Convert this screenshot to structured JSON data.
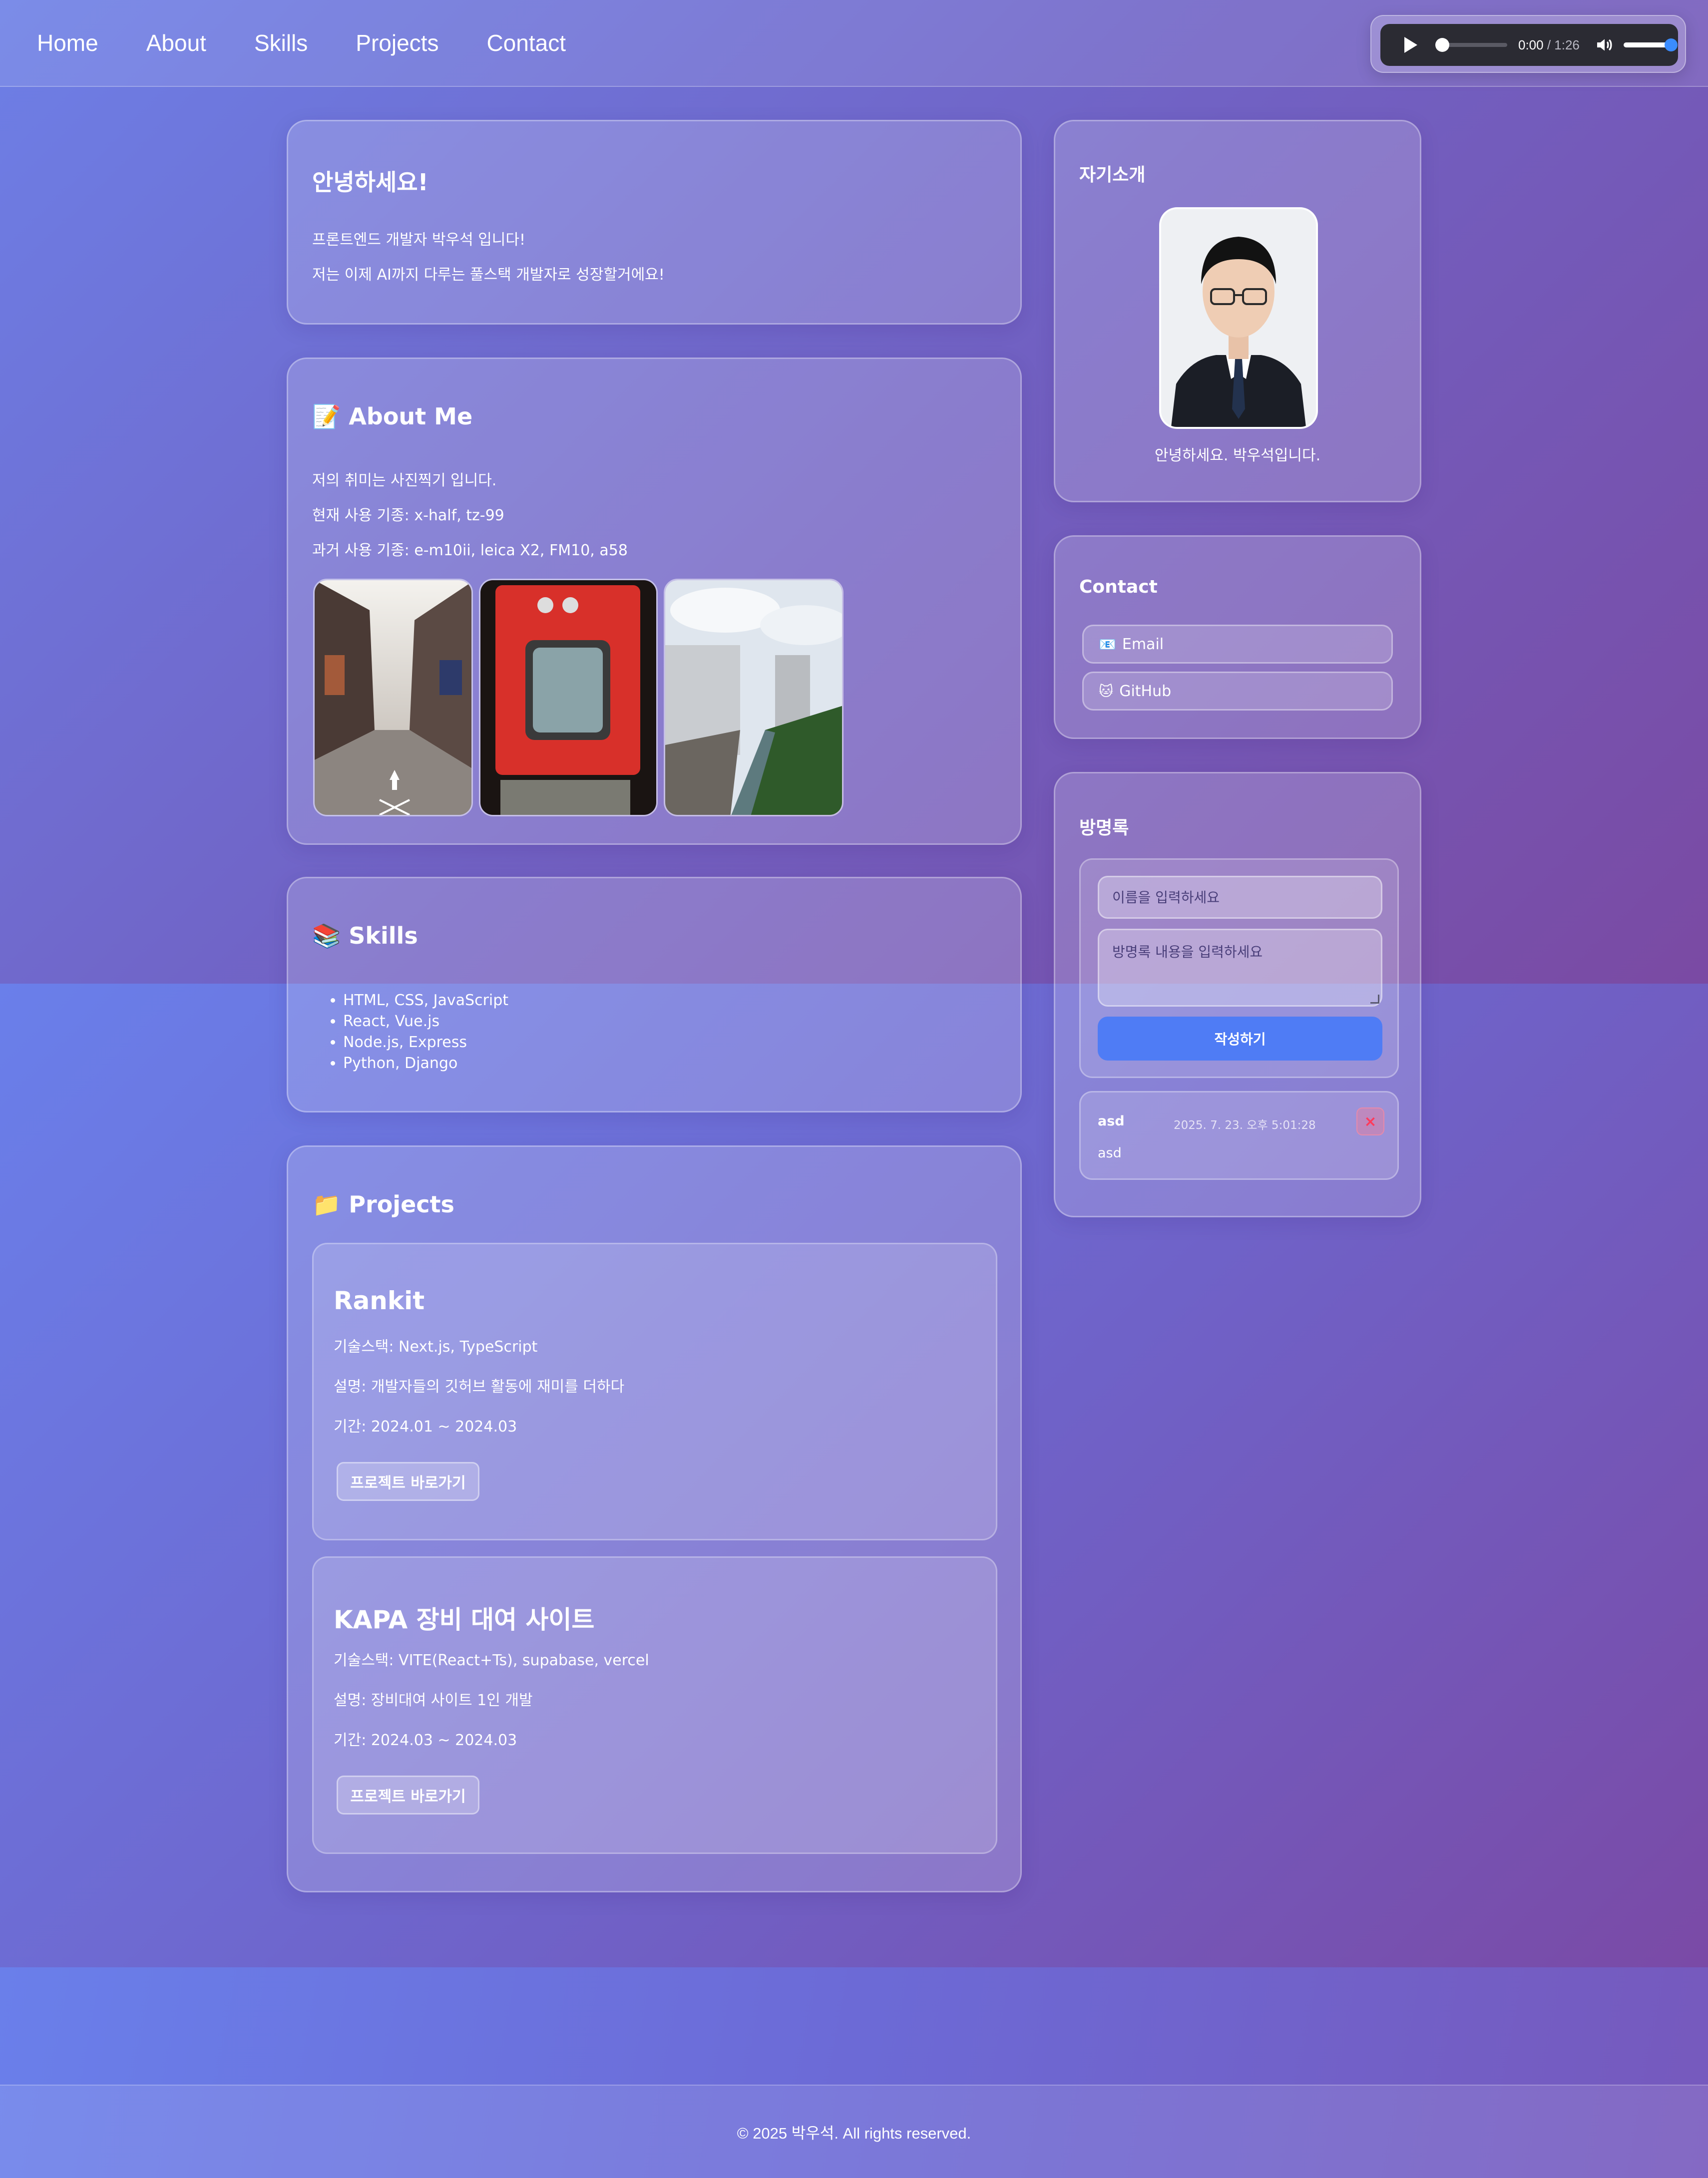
{
  "nav": {
    "items": [
      "Home",
      "About",
      "Skills",
      "Projects",
      "Contact"
    ]
  },
  "audio": {
    "current_time": "0:00",
    "total_time": " / 1:26",
    "progress": 0.0,
    "volume": 1.0
  },
  "hello": {
    "title": "안녕하세요!",
    "lines": [
      "프론트엔드 개발자 박우석 입니다!",
      "저는 이제 AI까지 다루는 풀스택 개발자로 성장할거에요!"
    ]
  },
  "about": {
    "icon": "📝",
    "title": "About Me",
    "lines": [
      "저의 취미는 사진찍기 입니다.",
      "현재 사용 기종: x-half, tz-99",
      "과거 사용 기종: e-m10ii, leica X2, FM10, a58"
    ]
  },
  "skills": {
    "icon": "📚",
    "title": "Skills",
    "items": [
      "HTML, CSS, JavaScript",
      "React, Vue.js",
      "Node.js, Express",
      "Python, Django"
    ]
  },
  "projects": {
    "icon": "📁",
    "title": "Projects",
    "items": [
      {
        "name": "Rankit",
        "stack": "기술스택: Next.js, TypeScript",
        "desc": "설명: 개발자들의 깃허브 활동에 재미를 더하다",
        "period": "기간: 2024.01 ~ 2024.03",
        "button": "프로젝트 바로가기"
      },
      {
        "name": "KAPA 장비 대여 사이트",
        "stack": "기술스택: VITE(React+Ts), supabase, vercel",
        "desc": "설명: 장비대여 사이트 1인 개발",
        "period": "기간: 2024.03 ~ 2024.03",
        "button": "프로젝트 바로가기"
      }
    ]
  },
  "profile": {
    "title": "자기소개",
    "caption": "안녕하세요. 박우석입니다."
  },
  "contact": {
    "title": "Contact",
    "email_icon": "📧",
    "email_label": "Email",
    "github_icon": "🐱",
    "github_label": "GitHub"
  },
  "guestbook": {
    "title": "방명록",
    "name_placeholder": "이름을 입력하세요",
    "message_placeholder": "방명록 내용을 입력하세요",
    "submit_label": "작성하기",
    "entries": [
      {
        "name": "asd",
        "date": "2025. 7. 23. 오후 5:01:28",
        "message": "asd",
        "delete_label": "×"
      }
    ]
  },
  "footer": {
    "text": "© 2025 박우석. All rights reserved."
  }
}
